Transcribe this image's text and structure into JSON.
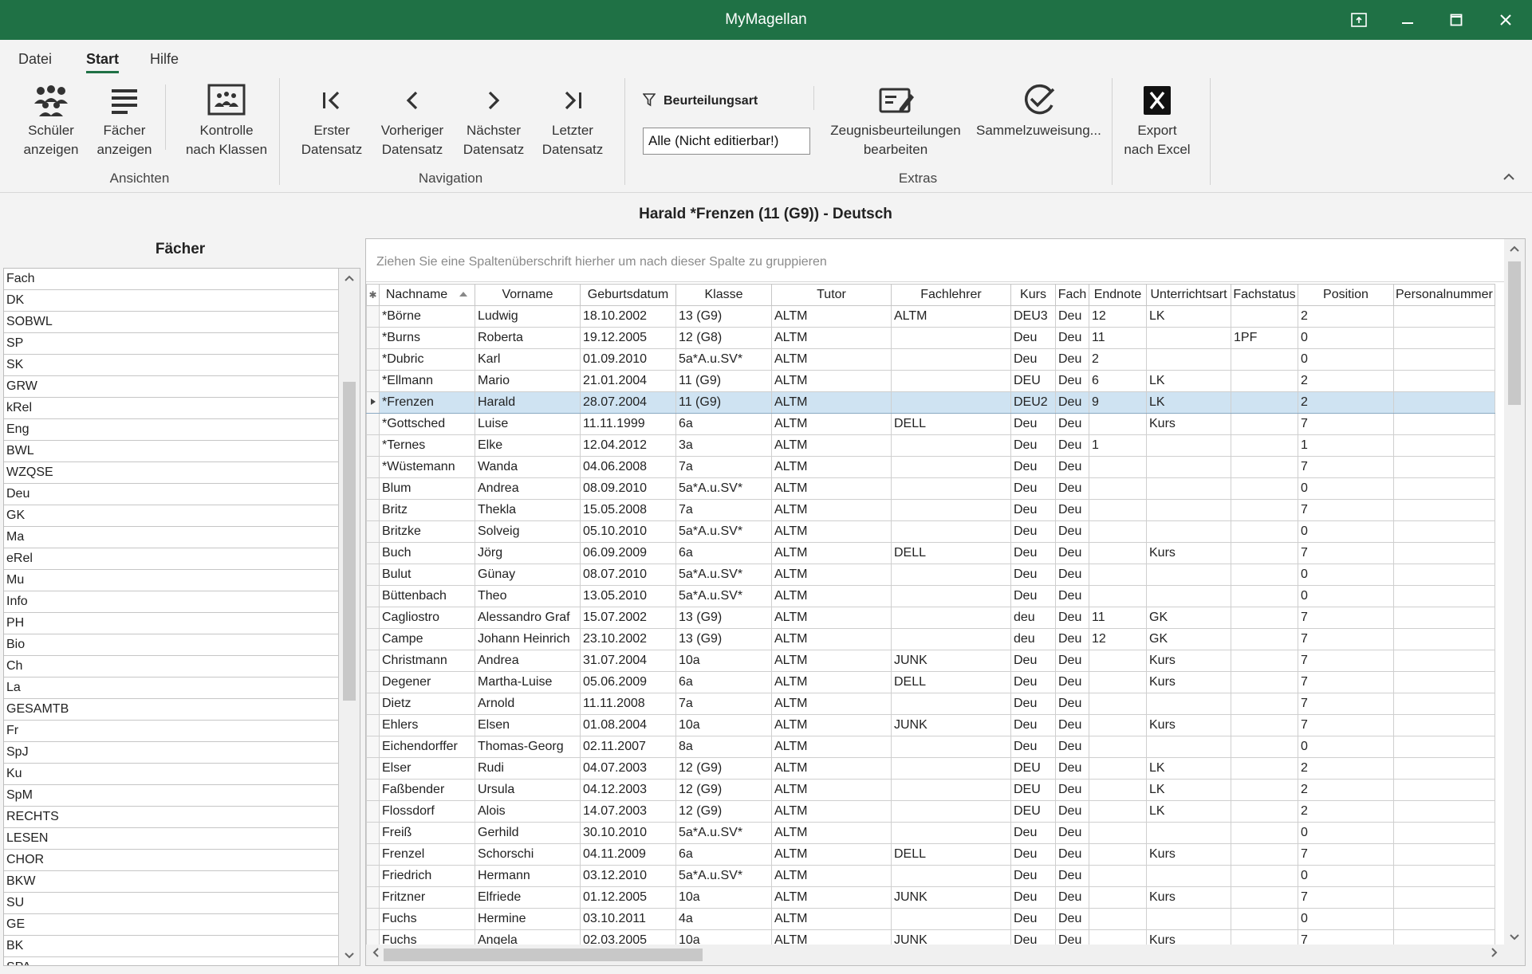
{
  "app": {
    "title": "MyMagellan"
  },
  "menu": {
    "tabs": [
      "Datei",
      "Start",
      "Hilfe"
    ]
  },
  "ribbon": {
    "ansichten": {
      "label": "Ansichten",
      "schueler": [
        "Schüler",
        "anzeigen"
      ],
      "faecher": [
        "Fächer",
        "anzeigen"
      ],
      "kontrolle": [
        "Kontrolle",
        "nach Klassen"
      ]
    },
    "navigation": {
      "label": "Navigation",
      "erster": [
        "Erster",
        "Datensatz"
      ],
      "vorheriger": [
        "Vorheriger",
        "Datensatz"
      ],
      "naechster": [
        "Nächster",
        "Datensatz"
      ],
      "letzter": [
        "Letzter",
        "Datensatz"
      ]
    },
    "extras": {
      "label": "Extras",
      "filter_label": "Beurteilungsart",
      "filter_value": "Alle (Nicht editierbar!)",
      "zeugnis": [
        "Zeugnisbeurteilungen",
        "bearbeiten"
      ],
      "sammel": [
        "Sammelzuweisung..."
      ],
      "export": [
        "Export",
        "nach Excel"
      ]
    }
  },
  "heading": "Harald *Frenzen (11 (G9)) - Deutsch",
  "faecher": {
    "title": "Fächer",
    "column": "Fach",
    "items": [
      "DK",
      "SOBWL",
      "SP",
      "SK",
      "GRW",
      "kRel",
      "Eng",
      "BWL",
      "WZQSE",
      "Deu",
      "GK",
      "Ma",
      "eRel",
      "Mu",
      "Info",
      "PH",
      "Bio",
      "Ch",
      "La",
      "GESAMTB",
      "Fr",
      "SpJ",
      "Ku",
      "SpM",
      "RECHTS",
      "LESEN",
      "CHOR",
      "BKW",
      "SU",
      "GE",
      "BK",
      "SPA"
    ]
  },
  "grid": {
    "group_hint": "Ziehen Sie eine Spaltenüberschrift hierher um nach dieser Spalte zu gruppieren",
    "columns": [
      "Nachname",
      "Vorname",
      "Geburtsdatum",
      "Klasse",
      "Tutor",
      "Fachlehrer",
      "Kurs",
      "Fach",
      "Endnote",
      "Unterrichtsart",
      "Fachstatus",
      "Position",
      "Personalnummer"
    ],
    "selected_index": 4,
    "rows": [
      [
        "*Börne",
        "Ludwig",
        "18.10.2002",
        "13 (G9)",
        "ALTM",
        "ALTM",
        "DEU3",
        "Deu",
        "12",
        "LK",
        "",
        "2",
        ""
      ],
      [
        "*Burns",
        "Roberta",
        "19.12.2005",
        "12 (G8)",
        "ALTM",
        "",
        "Deu",
        "Deu",
        "11",
        "",
        "1PF",
        "0",
        ""
      ],
      [
        "*Dubric",
        "Karl",
        "01.09.2010",
        "5a*A.u.SV*",
        "ALTM",
        "",
        "Deu",
        "Deu",
        "2",
        "",
        "",
        "0",
        ""
      ],
      [
        "*Ellmann",
        "Mario",
        "21.01.2004",
        "11 (G9)",
        "ALTM",
        "",
        "DEU",
        "Deu",
        "6",
        "LK",
        "",
        "2",
        ""
      ],
      [
        "*Frenzen",
        "Harald",
        "28.07.2004",
        "11 (G9)",
        "ALTM",
        "",
        "DEU2",
        "Deu",
        "9",
        "LK",
        "",
        "2",
        ""
      ],
      [
        "*Gottsched",
        "Luise",
        "11.11.1999",
        "6a",
        "ALTM",
        "DELL",
        "Deu",
        "Deu",
        "",
        "Kurs",
        "",
        "7",
        ""
      ],
      [
        "*Ternes",
        "Elke",
        "12.04.2012",
        "3a",
        "ALTM",
        "",
        "Deu",
        "Deu",
        "1",
        "",
        "",
        "1",
        ""
      ],
      [
        "*Wüstemann",
        "Wanda",
        "04.06.2008",
        "7a",
        "ALTM",
        "",
        "Deu",
        "Deu",
        "",
        "",
        "",
        "7",
        ""
      ],
      [
        "Blum",
        "Andrea",
        "08.09.2010",
        "5a*A.u.SV*",
        "ALTM",
        "",
        "Deu",
        "Deu",
        "",
        "",
        "",
        "0",
        ""
      ],
      [
        "Britz",
        "Thekla",
        "15.05.2008",
        "7a",
        "ALTM",
        "",
        "Deu",
        "Deu",
        "",
        "",
        "",
        "7",
        ""
      ],
      [
        "Britzke",
        "Solveig",
        "05.10.2010",
        "5a*A.u.SV*",
        "ALTM",
        "",
        "Deu",
        "Deu",
        "",
        "",
        "",
        "0",
        ""
      ],
      [
        "Buch",
        "Jörg",
        "06.09.2009",
        "6a",
        "ALTM",
        "DELL",
        "Deu",
        "Deu",
        "",
        "Kurs",
        "",
        "7",
        ""
      ],
      [
        "Bulut",
        "Günay",
        "08.07.2010",
        "5a*A.u.SV*",
        "ALTM",
        "",
        "Deu",
        "Deu",
        "",
        "",
        "",
        "0",
        ""
      ],
      [
        "Büttenbach",
        "Theo",
        "13.05.2010",
        "5a*A.u.SV*",
        "ALTM",
        "",
        "Deu",
        "Deu",
        "",
        "",
        "",
        "0",
        ""
      ],
      [
        "Cagliostro",
        "Alessandro Graf",
        "15.07.2002",
        "13 (G9)",
        "ALTM",
        "",
        "deu",
        "Deu",
        "11",
        "GK",
        "",
        "7",
        ""
      ],
      [
        "Campe",
        "Johann Heinrich",
        "23.10.2002",
        "13 (G9)",
        "ALTM",
        "",
        "deu",
        "Deu",
        "12",
        "GK",
        "",
        "7",
        ""
      ],
      [
        "Christmann",
        "Andrea",
        "31.07.2004",
        "10a",
        "ALTM",
        "JUNK",
        "Deu",
        "Deu",
        "",
        "Kurs",
        "",
        "7",
        ""
      ],
      [
        "Degener",
        "Martha-Luise",
        "05.06.2009",
        "6a",
        "ALTM",
        "DELL",
        "Deu",
        "Deu",
        "",
        "Kurs",
        "",
        "7",
        ""
      ],
      [
        "Dietz",
        "Arnold",
        "11.11.2008",
        "7a",
        "ALTM",
        "",
        "Deu",
        "Deu",
        "",
        "",
        "",
        "7",
        ""
      ],
      [
        "Ehlers",
        "Elsen",
        "01.08.2004",
        "10a",
        "ALTM",
        "JUNK",
        "Deu",
        "Deu",
        "",
        "Kurs",
        "",
        "7",
        ""
      ],
      [
        "Eichendorffer",
        "Thomas-Georg",
        "02.11.2007",
        "8a",
        "ALTM",
        "",
        "Deu",
        "Deu",
        "",
        "",
        "",
        "0",
        ""
      ],
      [
        "Elser",
        "Rudi",
        "04.07.2003",
        "12 (G9)",
        "ALTM",
        "",
        "DEU",
        "Deu",
        "",
        "LK",
        "",
        "2",
        ""
      ],
      [
        "Faßbender",
        "Ursula",
        "04.12.2003",
        "12 (G9)",
        "ALTM",
        "",
        "DEU",
        "Deu",
        "",
        "LK",
        "",
        "2",
        ""
      ],
      [
        "Flossdorf",
        "Alois",
        "14.07.2003",
        "12 (G9)",
        "ALTM",
        "",
        "DEU",
        "Deu",
        "",
        "LK",
        "",
        "2",
        ""
      ],
      [
        "Freiß",
        "Gerhild",
        "30.10.2010",
        "5a*A.u.SV*",
        "ALTM",
        "",
        "Deu",
        "Deu",
        "",
        "",
        "",
        "0",
        ""
      ],
      [
        "Frenzel",
        "Schorschi",
        "04.11.2009",
        "6a",
        "ALTM",
        "DELL",
        "Deu",
        "Deu",
        "",
        "Kurs",
        "",
        "7",
        ""
      ],
      [
        "Friedrich",
        "Hermann",
        "03.12.2010",
        "5a*A.u.SV*",
        "ALTM",
        "",
        "Deu",
        "Deu",
        "",
        "",
        "",
        "0",
        ""
      ],
      [
        "Fritzner",
        "Elfriede",
        "01.12.2005",
        "10a",
        "ALTM",
        "JUNK",
        "Deu",
        "Deu",
        "",
        "Kurs",
        "",
        "7",
        ""
      ],
      [
        "Fuchs",
        "Hermine",
        "03.10.2011",
        "4a",
        "ALTM",
        "",
        "Deu",
        "Deu",
        "",
        "",
        "",
        "0",
        ""
      ],
      [
        "Fuchs",
        "Angela",
        "02.03.2005",
        "10a",
        "ALTM",
        "JUNK",
        "Deu",
        "Deu",
        "",
        "Kurs",
        "",
        "7",
        ""
      ]
    ]
  }
}
